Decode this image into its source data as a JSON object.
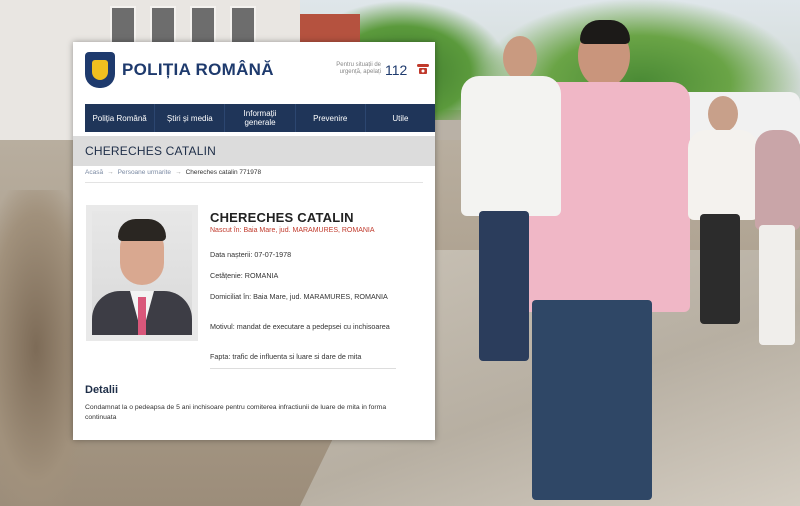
{
  "header": {
    "brand": "POLIȚIA ROMÂNĂ",
    "emergency_text": "Pentru situații de urgență, apelați",
    "emergency_number": "112"
  },
  "nav": [
    {
      "label": "Poliția Română"
    },
    {
      "label": "Știri și media"
    },
    {
      "label": "Informații generale"
    },
    {
      "label": "Prevenire"
    },
    {
      "label": "Utile"
    }
  ],
  "page_title": "CHERECHES CATALIN",
  "breadcrumb": {
    "home": "Acasă",
    "section": "Persoane urmarite",
    "current": "Chereches catalin 771978"
  },
  "profile": {
    "name": "CHERECHES CATALIN",
    "birthplace": "Nascut în: Baia Mare, jud. MARAMURES, ROMANIA",
    "dob": "Data nașterii: 07-07-1978",
    "citizenship": "Cetățenie: ROMANIA",
    "domicile": "Domiciliat în: Baia Mare, jud. MARAMURES, ROMANIA",
    "motive": "Motivul: mandat de executare a pedepsei cu inchisoarea",
    "fact": "Fapta: trafic de influenta si luare si dare de mita"
  },
  "details": {
    "title": "Detalii",
    "text": "Condamnat la o pedeapsa de 5 ani inchisoare pentru comiterea infractiunii de luare de mita in forma continuata"
  },
  "colors": {
    "navy": "#1f3559",
    "accent_red": "#c0392b",
    "title_bar": "#dcdcdc"
  },
  "icons": {
    "crest": "police-crest-icon",
    "phone": "phone-icon"
  }
}
